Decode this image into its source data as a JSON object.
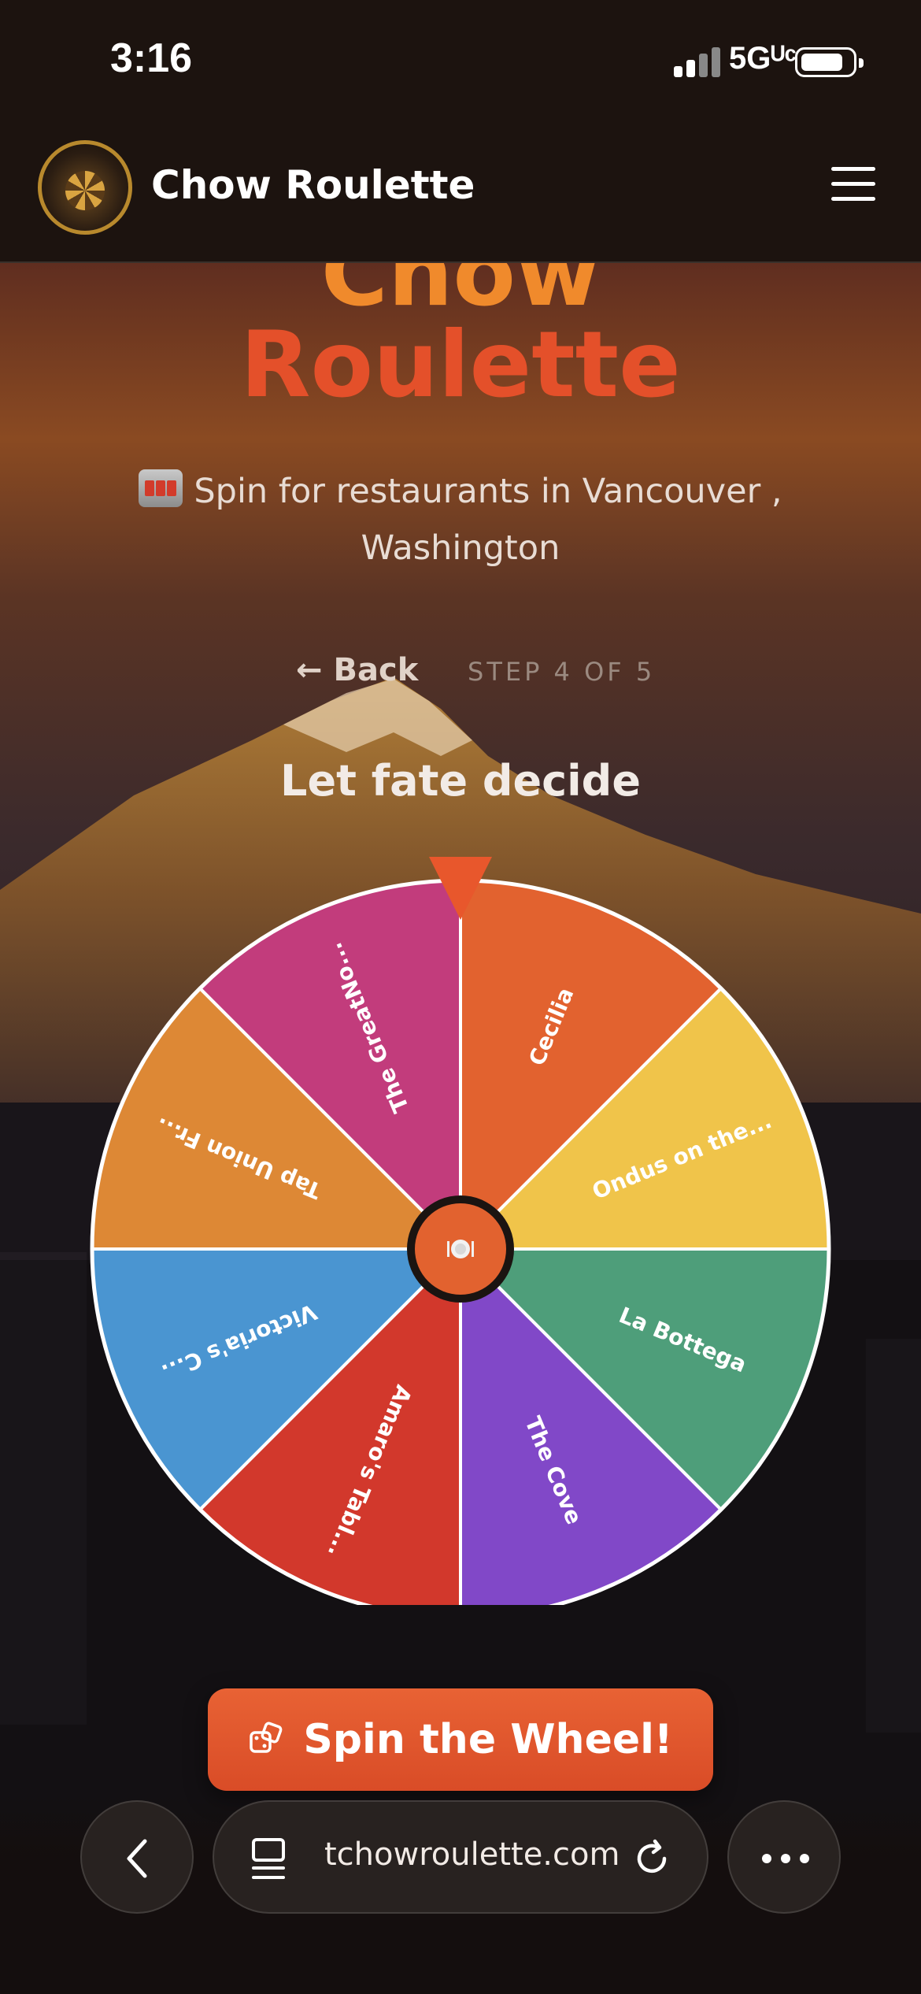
{
  "status_bar": {
    "time": "3:16",
    "network": "5Gᵁᶜ"
  },
  "header": {
    "app_name": "Chow Roulette"
  },
  "hero": {
    "title_line1": "Chow",
    "title_line2": "Roulette",
    "subtitle": "Spin for restaurants in Vancouver , Washington"
  },
  "navigation": {
    "back_label": "Back",
    "step_label": "STEP 4 OF 5"
  },
  "section_title": "Let fate decide",
  "wheel": {
    "center_icon": "plate-icon",
    "segments": [
      {
        "label": "Cecilia",
        "color": "#e2622f"
      },
      {
        "label": "Ondus on the...",
        "color": "#f0c44a"
      },
      {
        "label": "La Bottega",
        "color": "#4e9e7a"
      },
      {
        "label": "The Cove",
        "color": "#8148c8"
      },
      {
        "label": "Amaro's Tabl...",
        "color": "#d2382c"
      },
      {
        "label": "Victoria's C...",
        "color": "#4a95d1"
      },
      {
        "label": "Tap Union Fr...",
        "color": "#dd8835"
      },
      {
        "label": "The GreatNo...",
        "color": "#c23c7c"
      }
    ]
  },
  "spin_button": {
    "label": "Spin the Wheel!",
    "icon": "dice-icon"
  },
  "browser": {
    "url": "tchowroulette.com"
  },
  "colors": {
    "accent": "#e4502a",
    "title_orange": "#f08a2c",
    "pointer": "#e8572c"
  }
}
